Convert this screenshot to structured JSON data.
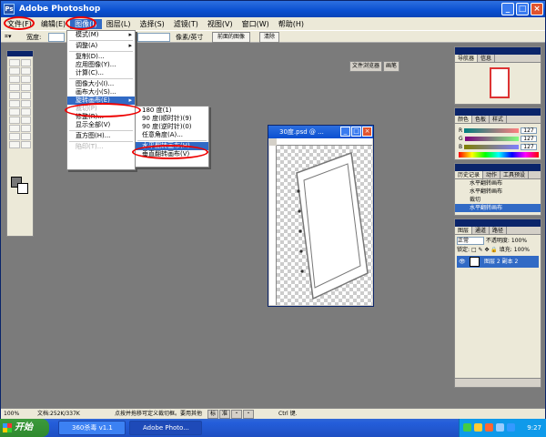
{
  "window": {
    "title": "Adobe Photoshop",
    "logo_text": "Ps"
  },
  "menubar": [
    {
      "label": "文件(F)"
    },
    {
      "label": "编辑(E)"
    },
    {
      "label": "图像(I)"
    },
    {
      "label": "图层(L)"
    },
    {
      "label": "选择(S)"
    },
    {
      "label": "滤镜(T)"
    },
    {
      "label": "视图(V)"
    },
    {
      "label": "窗口(W)"
    },
    {
      "label": "帮助(H)"
    }
  ],
  "options": {
    "width_label": "宽度:",
    "resolution_unit": "像素/英寸",
    "front_image_button": "前面的图像",
    "clear_button": "清除",
    "palette_tabs": [
      "文件浏览器",
      "画笔"
    ]
  },
  "image_menu": {
    "items": [
      "模式(M)",
      "调整(A)",
      "复制(D)...",
      "应用图像(Y)...",
      "计算(C)...",
      "图像大小(I)...",
      "画布大小(S)...",
      "旋转画布(E)",
      "裁切(P)",
      "修整(R)...",
      "显示全部(V)",
      "直方图(H)...",
      "陷印(T)..."
    ]
  },
  "rotate_submenu": {
    "items": [
      "180 度(1)",
      "90 度(顺时针)(9)",
      "90 度(逆时针)(0)",
      "任意角度(A)...",
      "水平翻转画布(H)",
      "垂直翻转画布(V)"
    ]
  },
  "document": {
    "title": "30度.psd @ ..."
  },
  "navigator": {
    "tabs": [
      "导航器",
      "信息"
    ]
  },
  "color_panel": {
    "tabs": [
      "颜色",
      "色板",
      "样式"
    ],
    "r": "127",
    "g": "127",
    "b": "127",
    "r_label": "R",
    "g_label": "G",
    "b_label": "B"
  },
  "history": {
    "tabs": [
      "历史记录",
      "动作",
      "工具预设"
    ],
    "items": [
      "水平翻转画布",
      "水平翻转画布",
      "裁切",
      "水平翻转画布"
    ]
  },
  "layers": {
    "tabs": [
      "图层",
      "通道",
      "路径"
    ],
    "blend_mode": "正常",
    "opacity_label": "不透明度:",
    "opacity": "100%",
    "lock_label": "锁定:",
    "fill_label": "填充:",
    "fill": "100%",
    "layer_name": "图层 2 副本 2"
  },
  "status": {
    "zoom": "100%",
    "doc_size": "文档:252K/337K",
    "hint": "点按并拖移可定义裁切框。要用其他",
    "hint_tail": "Ctrl 键.",
    "ime": [
      "标",
      "准",
      "・",
      "・"
    ]
  },
  "taskbar": {
    "start": "开始",
    "tasks": [
      "360杀毒 v1.1",
      "Adobe Photo..."
    ],
    "clock": "9:27"
  },
  "colors": {
    "selection": "#316ac5",
    "highlight_ring": "#e00000"
  }
}
